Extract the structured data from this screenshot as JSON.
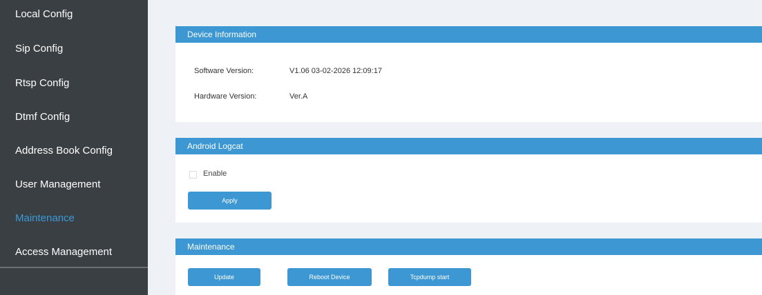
{
  "sidebar": {
    "items": [
      {
        "label": "Local Config",
        "active": false
      },
      {
        "label": "Sip Config",
        "active": false
      },
      {
        "label": "Rtsp Config",
        "active": false
      },
      {
        "label": "Dtmf Config",
        "active": false
      },
      {
        "label": "Address Book Config",
        "active": false
      },
      {
        "label": "User Management",
        "active": false
      },
      {
        "label": "Maintenance",
        "active": true
      },
      {
        "label": "Access Management",
        "active": false
      }
    ]
  },
  "device_info": {
    "title": "Device Information",
    "software_label": "Software Version:",
    "software_value": "V1.06 03-02-2026 12:09:17",
    "hardware_label": "Hardware Version:",
    "hardware_value": "Ver.A"
  },
  "logcat": {
    "title": "Android Logcat",
    "enable_label": "Enable",
    "enabled": false,
    "apply_label": "Apply"
  },
  "maintenance": {
    "title": "Maintenance",
    "update_label": "Update",
    "reboot_label": "Reboot Device",
    "tcpdump_label": "Tcpdump start"
  },
  "colors": {
    "sidebar_bg": "#3a3f44",
    "accent": "#3c97d2",
    "active_nav": "#3a9ad9",
    "content_bg": "#eef1f6"
  }
}
